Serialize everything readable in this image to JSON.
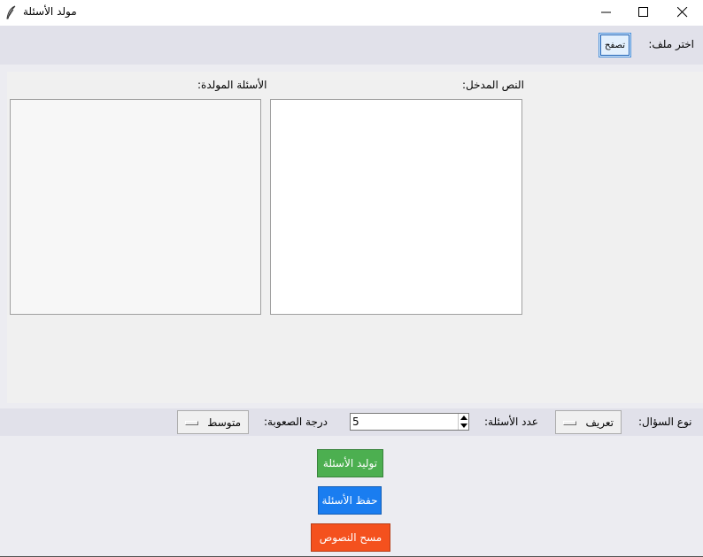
{
  "window": {
    "title": "مولد الأسئلة",
    "icon": "feather-icon"
  },
  "file": {
    "label": "اختر ملف:",
    "browse_label": "تصفح"
  },
  "panes": {
    "input_label": "النص المدخل:",
    "output_label": "الأسئلة المولدة:",
    "input_text": "",
    "output_text": ""
  },
  "options": {
    "question_type_label": "نوع السؤال:",
    "question_type_value": "تعريف",
    "count_label": "عدد الأسئلة:",
    "count_value": "5",
    "difficulty_label": "درجة الصعوبة:",
    "difficulty_value": "متوسط"
  },
  "actions": {
    "generate_label": "توليد الأسئلة",
    "save_label": "حفظ الأسئلة",
    "clear_label": "مسح النصوص"
  },
  "colors": {
    "generate": "#4caf50",
    "save": "#1a7df0",
    "clear": "#f4511e",
    "bar": "#e1e1ea"
  }
}
